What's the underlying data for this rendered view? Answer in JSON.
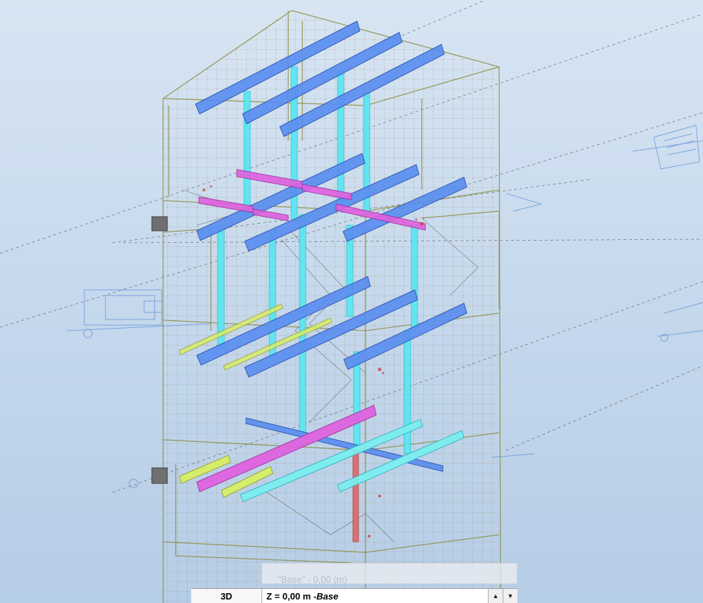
{
  "viewport": {
    "colors": {
      "background": "#c8dbee",
      "grid_wall": "#8a8a3a",
      "node": "#d04040",
      "beam_primary": "#5b8ff0",
      "column": "#5ee6f2",
      "beam_secondary": "#e060e0",
      "beam_light": "#d8f060",
      "beam_cyan": "#7af0f0",
      "drawing_lines": "#5a8cd8",
      "support": "#707070"
    }
  },
  "level_tooltip": {
    "text": "\"Base\" - 0,00 (m)"
  },
  "view_bar": {
    "mode_label": "3D",
    "level_value": "Z = 0,00 m - ",
    "level_name": "Base",
    "spin_up_icon": "triangle-up-icon",
    "spin_down_icon": "triangle-down-icon"
  }
}
